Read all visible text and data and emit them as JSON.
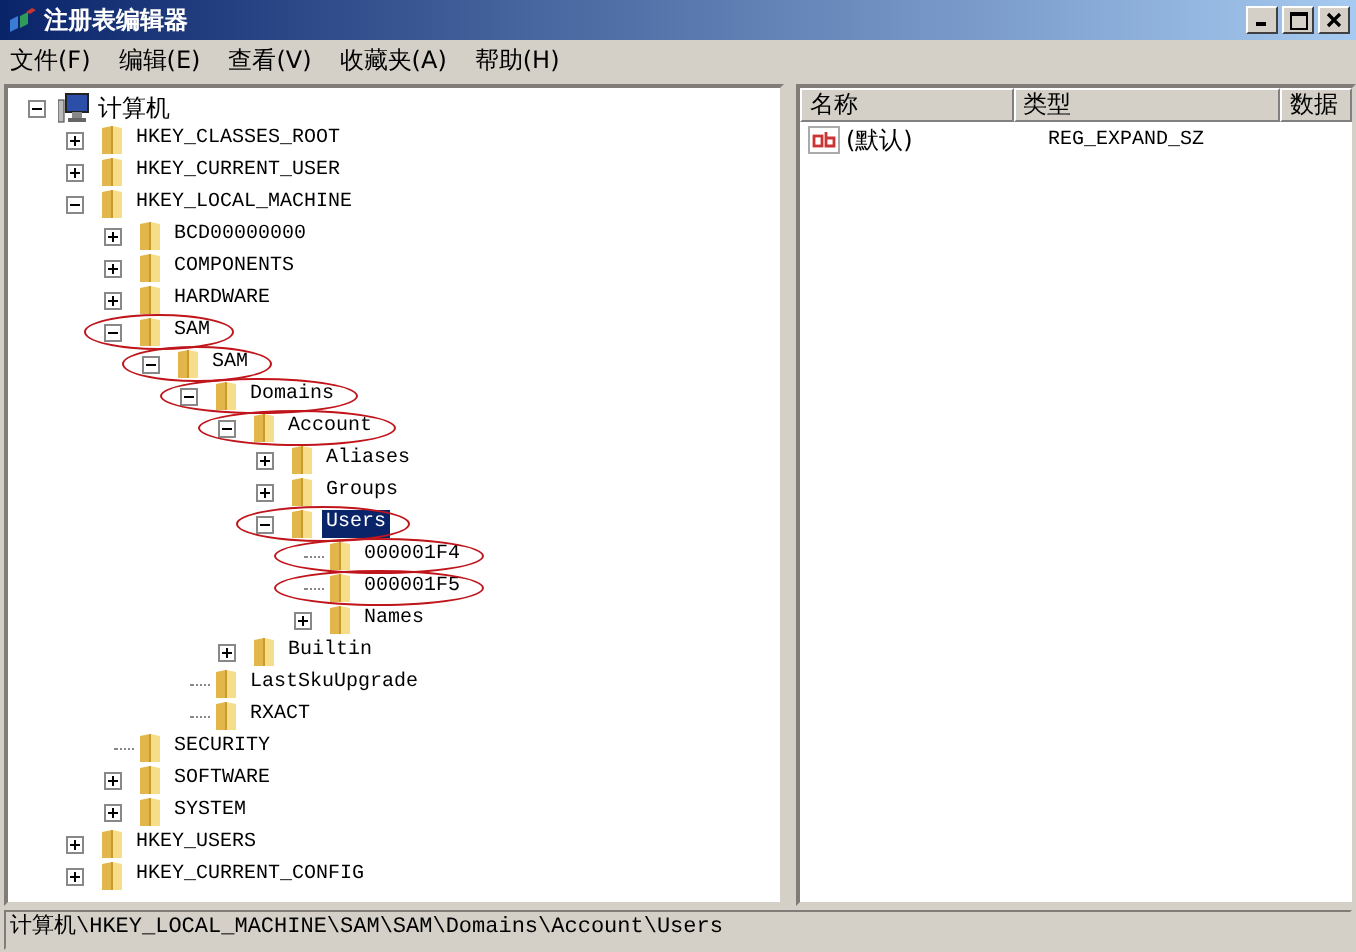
{
  "window": {
    "title": "注册表编辑器"
  },
  "menu": [
    "文件(F)",
    "编辑(E)",
    "查看(V)",
    "收藏夹(A)",
    "帮助(H)"
  ],
  "tree": [
    {
      "label": "计算机",
      "kind": "computer",
      "expandable": true,
      "expanded": true,
      "selected": false,
      "circled": false,
      "children": [
        {
          "label": "HKEY_CLASSES_ROOT",
          "kind": "folder",
          "expandable": true,
          "expanded": false,
          "selected": false,
          "circled": false
        },
        {
          "label": "HKEY_CURRENT_USER",
          "kind": "folder",
          "expandable": true,
          "expanded": false,
          "selected": false,
          "circled": false
        },
        {
          "label": "HKEY_LOCAL_MACHINE",
          "kind": "folder",
          "expandable": true,
          "expanded": true,
          "selected": false,
          "circled": false,
          "children": [
            {
              "label": "BCD00000000",
              "kind": "folder",
              "expandable": true,
              "expanded": false,
              "selected": false,
              "circled": false
            },
            {
              "label": "COMPONENTS",
              "kind": "folder",
              "expandable": true,
              "expanded": false,
              "selected": false,
              "circled": false
            },
            {
              "label": "HARDWARE",
              "kind": "folder",
              "expandable": true,
              "expanded": false,
              "selected": false,
              "circled": false
            },
            {
              "label": "SAM",
              "kind": "folder",
              "expandable": true,
              "expanded": true,
              "selected": false,
              "circled": true,
              "children": [
                {
                  "label": "SAM",
                  "kind": "folder",
                  "expandable": true,
                  "expanded": true,
                  "selected": false,
                  "circled": true,
                  "children": [
                    {
                      "label": "Domains",
                      "kind": "folder",
                      "expandable": true,
                      "expanded": true,
                      "selected": false,
                      "circled": true,
                      "children": [
                        {
                          "label": "Account",
                          "kind": "folder",
                          "expandable": true,
                          "expanded": true,
                          "selected": false,
                          "circled": true,
                          "children": [
                            {
                              "label": "Aliases",
                              "kind": "folder",
                              "expandable": true,
                              "expanded": false,
                              "selected": false,
                              "circled": false
                            },
                            {
                              "label": "Groups",
                              "kind": "folder",
                              "expandable": true,
                              "expanded": false,
                              "selected": false,
                              "circled": false
                            },
                            {
                              "label": "Users",
                              "kind": "folder",
                              "expandable": true,
                              "expanded": true,
                              "selected": true,
                              "circled": true,
                              "children": [
                                {
                                  "label": "000001F4",
                                  "kind": "folder",
                                  "expandable": false,
                                  "selected": false,
                                  "circled": true
                                },
                                {
                                  "label": "000001F5",
                                  "kind": "folder",
                                  "expandable": false,
                                  "selected": false,
                                  "circled": true
                                },
                                {
                                  "label": "Names",
                                  "kind": "folder",
                                  "expandable": true,
                                  "expanded": false,
                                  "selected": false,
                                  "circled": false
                                }
                              ]
                            }
                          ]
                        },
                        {
                          "label": "Builtin",
                          "kind": "folder",
                          "expandable": true,
                          "expanded": false,
                          "selected": false,
                          "circled": false
                        }
                      ]
                    },
                    {
                      "label": "LastSkuUpgrade",
                      "kind": "folder",
                      "expandable": false,
                      "selected": false,
                      "circled": false
                    },
                    {
                      "label": "RXACT",
                      "kind": "folder",
                      "expandable": false,
                      "selected": false,
                      "circled": false
                    }
                  ]
                }
              ]
            },
            {
              "label": "SECURITY",
              "kind": "folder",
              "expandable": false,
              "selected": false,
              "circled": false
            },
            {
              "label": "SOFTWARE",
              "kind": "folder",
              "expandable": true,
              "expanded": false,
              "selected": false,
              "circled": false
            },
            {
              "label": "SYSTEM",
              "kind": "folder",
              "expandable": true,
              "expanded": false,
              "selected": false,
              "circled": false
            }
          ]
        },
        {
          "label": "HKEY_USERS",
          "kind": "folder",
          "expandable": true,
          "expanded": false,
          "selected": false,
          "circled": false
        },
        {
          "label": "HKEY_CURRENT_CONFIG",
          "kind": "folder",
          "expandable": true,
          "expanded": false,
          "selected": false,
          "circled": false
        }
      ]
    }
  ],
  "values": {
    "columns": [
      "名称",
      "类型",
      "数据"
    ],
    "rows": [
      {
        "name": "(默认)",
        "type": "REG_EXPAND_SZ"
      }
    ]
  },
  "status_bar": "计算机\\HKEY_LOCAL_MACHINE\\SAM\\SAM\\Domains\\Account\\Users"
}
